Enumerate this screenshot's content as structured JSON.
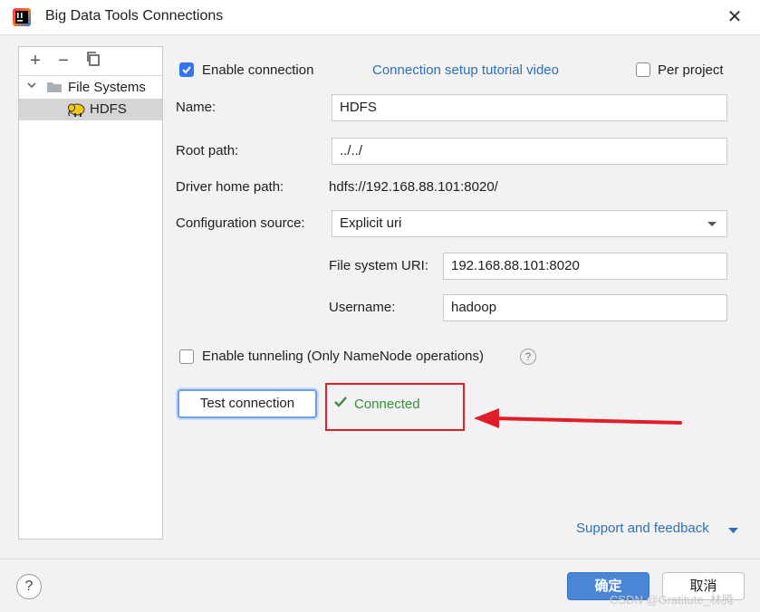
{
  "window": {
    "title": "Big Data Tools Connections"
  },
  "tree": {
    "root_label": "File Systems",
    "child_label": "HDFS"
  },
  "form": {
    "enable_connection_label": "Enable connection",
    "tutorial_link": "Connection setup tutorial video",
    "per_project_label": "Per project",
    "name_label": "Name:",
    "name_value": "HDFS",
    "root_path_label": "Root path:",
    "root_path_value": "../../",
    "driver_home_label": "Driver home path:",
    "driver_home_value": "hdfs://192.168.88.101:8020/",
    "config_source_label": "Configuration source:",
    "config_source_value": "Explicit uri",
    "fs_uri_label": "File system URI:",
    "fs_uri_value": "192.168.88.101:8020",
    "username_label": "Username:",
    "username_value": "hadoop",
    "tunneling_label": "Enable tunneling (Only NameNode operations)",
    "test_button": "Test connection",
    "status_text": "Connected",
    "enable_connection_checked": true,
    "per_project_checked": false,
    "tunneling_checked": false
  },
  "footer": {
    "support_link": "Support and feedback",
    "ok_button": "确定",
    "cancel_button": "取消",
    "watermark": "CSDN @Gratitute_林腾"
  },
  "colors": {
    "accent": "#3574f0",
    "status_green": "#3c8c3c",
    "annotation_red": "#e11d2a"
  }
}
